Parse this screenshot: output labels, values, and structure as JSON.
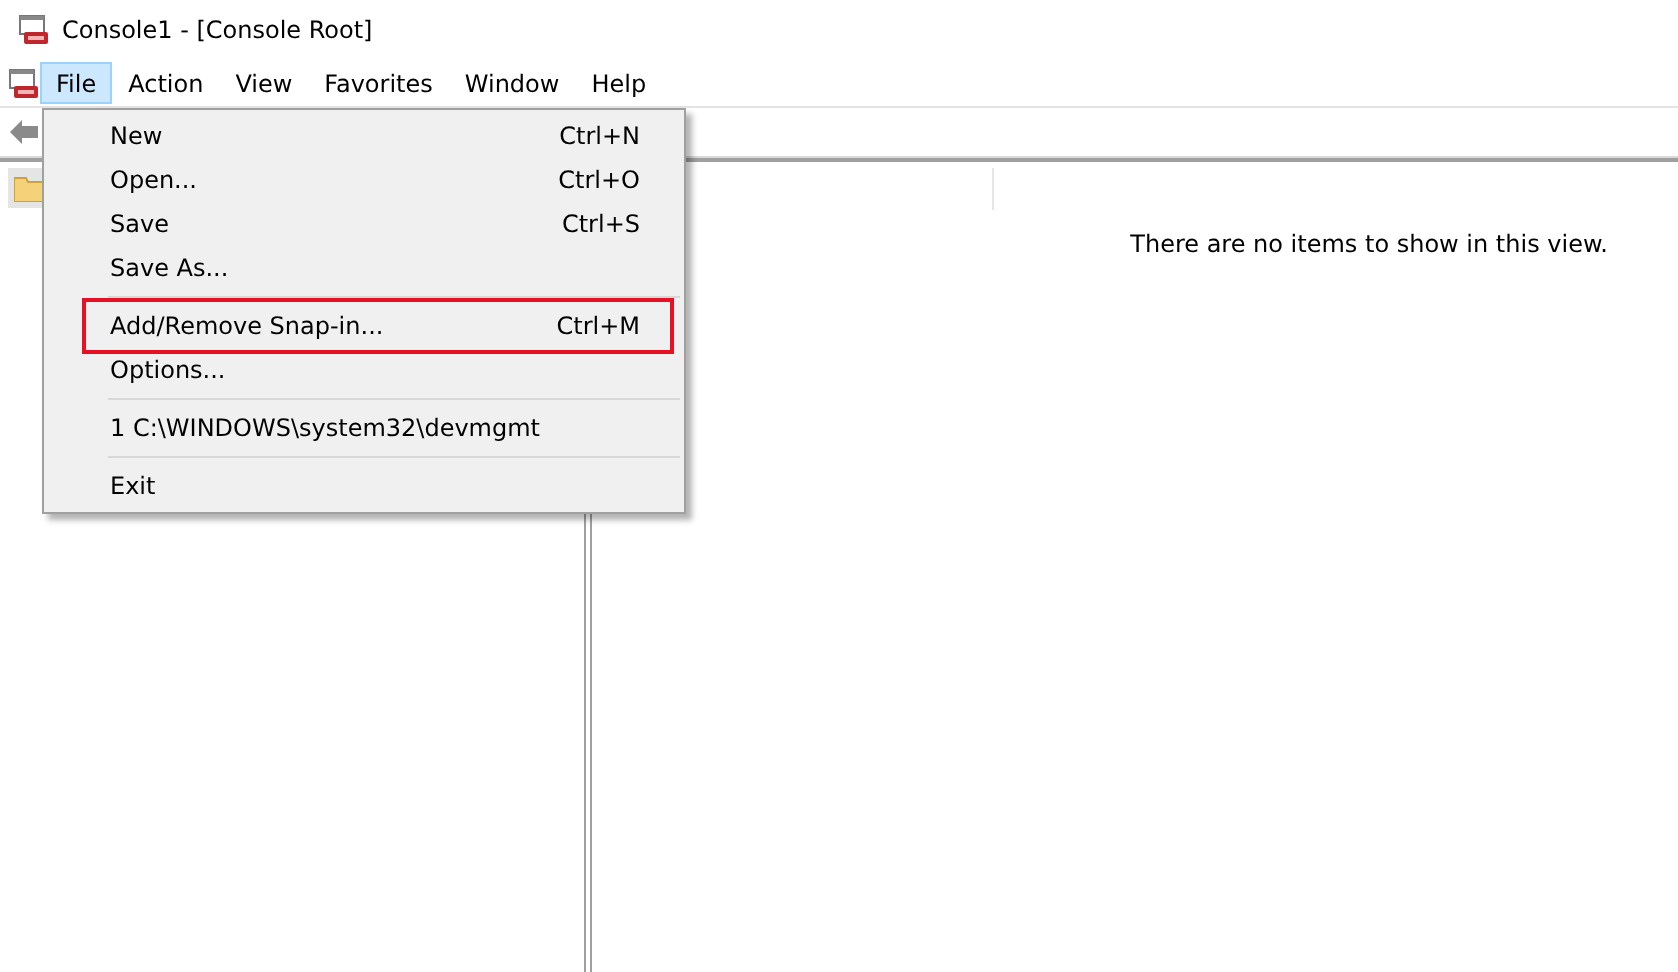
{
  "window": {
    "title": "Console1 - [Console Root]"
  },
  "menubar": [
    {
      "label": "File",
      "selected": true
    },
    {
      "label": "Action",
      "selected": false
    },
    {
      "label": "View",
      "selected": false
    },
    {
      "label": "Favorites",
      "selected": false
    },
    {
      "label": "Window",
      "selected": false
    },
    {
      "label": "Help",
      "selected": false
    }
  ],
  "file_menu": [
    {
      "kind": "item",
      "label": "New",
      "shortcut": "Ctrl+N",
      "outlined": false
    },
    {
      "kind": "item",
      "label": "Open...",
      "shortcut": "Ctrl+O",
      "outlined": false
    },
    {
      "kind": "item",
      "label": "Save",
      "shortcut": "Ctrl+S",
      "outlined": false
    },
    {
      "kind": "item",
      "label": "Save As...",
      "outlined": false
    },
    {
      "kind": "separator"
    },
    {
      "kind": "item",
      "label": "Add/Remove Snap-in...",
      "shortcut": "Ctrl+M",
      "outlined": true
    },
    {
      "kind": "item",
      "label": "Options...",
      "outlined": false
    },
    {
      "kind": "separator"
    },
    {
      "kind": "item",
      "label": "1 C:\\WINDOWS\\system32\\devmgmt",
      "outlined": false
    },
    {
      "kind": "separator"
    },
    {
      "kind": "item",
      "label": "Exit",
      "outlined": false
    }
  ],
  "results_pane": {
    "empty_message": "There are no items to show in this view."
  }
}
